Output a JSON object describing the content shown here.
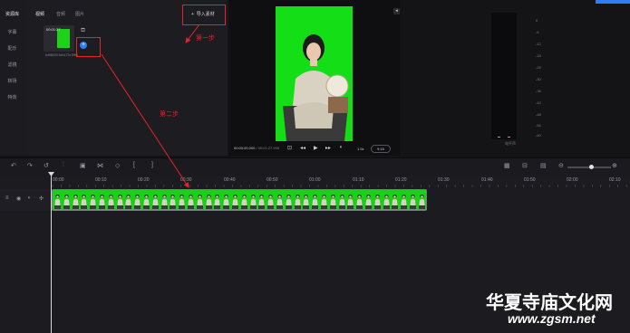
{
  "left_nav": {
    "items": [
      {
        "label": "资源库",
        "active": true
      },
      {
        "label": "字幕"
      },
      {
        "label": "配乐"
      },
      {
        "label": "滤镜"
      },
      {
        "label": "转场"
      },
      {
        "label": "特效"
      }
    ]
  },
  "media_panel": {
    "tabs": [
      {
        "label": "视频",
        "active": true
      },
      {
        "label": "音频"
      },
      {
        "label": "图片"
      }
    ],
    "import_label": "导入素材",
    "asset": {
      "duration": "00:01:27",
      "filename": "b498029-9b4172c7f9f6"
    },
    "add_symbol": "+"
  },
  "preview": {
    "time_current": "00:00:00.000",
    "time_total": "/ 00:01:27.995",
    "speed": "1.5x",
    "ratio": "9:16"
  },
  "meter": {
    "db_labels": [
      "0",
      "-6",
      "-12",
      "-18",
      "-24",
      "-30",
      "-36",
      "-42",
      "-48",
      "-54",
      "-60"
    ],
    "label": "电平声",
    "peak_color": "#e38b1a"
  },
  "timeline": {
    "ruler_ticks": [
      "00:00",
      "00:10",
      "00:20",
      "00:30",
      "00:40",
      "00:50",
      "01:00",
      "01:10",
      "01:20",
      "01:30",
      "01:40",
      "01:50",
      "02:00",
      "02:10"
    ],
    "clip_color": "#19d11b",
    "zoom_level": 0.5
  },
  "annotations": {
    "step1": "第一步",
    "step2": "第二步",
    "color": "#e5242a"
  },
  "watermark": {
    "line1": "华夏寺庙文化网",
    "line2": "www.zgsm.net"
  },
  "icons": {
    "undo": "undo-icon",
    "redo": "redo-icon",
    "split": "split-icon",
    "delete": "delete-icon",
    "play": "play-icon"
  }
}
